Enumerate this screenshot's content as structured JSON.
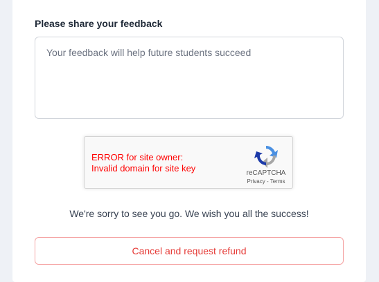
{
  "feedback": {
    "label": "Please share your feedback",
    "placeholder": "Your feedback will help future students succeed",
    "value": ""
  },
  "recaptcha": {
    "error_line1": "ERROR for site owner:",
    "error_line2": "Invalid domain for site key",
    "brand": "reCAPTCHA",
    "privacy_label": "Privacy",
    "separator": " - ",
    "terms_label": "Terms",
    "icon": "recaptcha-logo-icon"
  },
  "message": "We're sorry to see you go. We wish you all the success!",
  "cancel_button_label": "Cancel and request refund",
  "colors": {
    "error_red": "#ff0000",
    "danger": "#e53935",
    "danger_border": "#f5a3a3",
    "background": "#eef1f6"
  }
}
